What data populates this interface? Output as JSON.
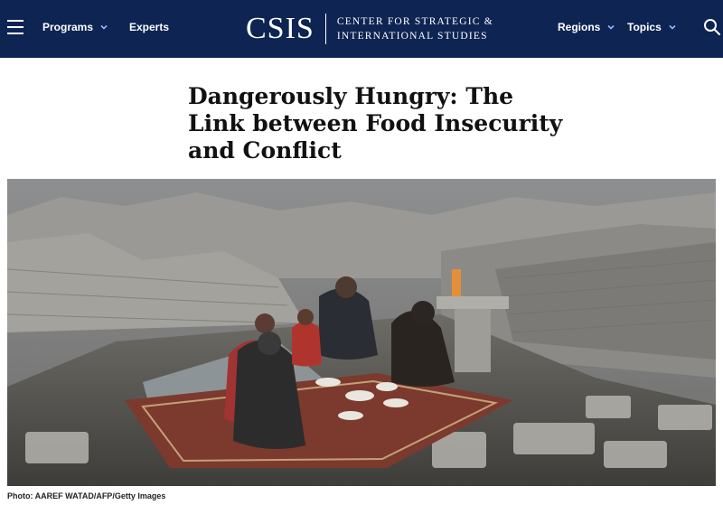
{
  "header": {
    "nav": {
      "programs": "Programs",
      "experts": "Experts",
      "regions": "Regions",
      "topics": "Topics"
    },
    "logo": {
      "mark": "CSIS",
      "line1": "CENTER FOR STRATEGIC &",
      "line2": "INTERNATIONAL STUDIES"
    },
    "colors": {
      "background": "#0e2453",
      "text": "#ffffff"
    },
    "icons": [
      "menu-icon",
      "chevron-down-icon",
      "search-icon"
    ]
  },
  "article": {
    "title": "Dangerously Hungry: The Link between Food Insecurity and Conflict",
    "photo_credit": "Photo: AAREF WATAD/AFP/Getty Images"
  }
}
